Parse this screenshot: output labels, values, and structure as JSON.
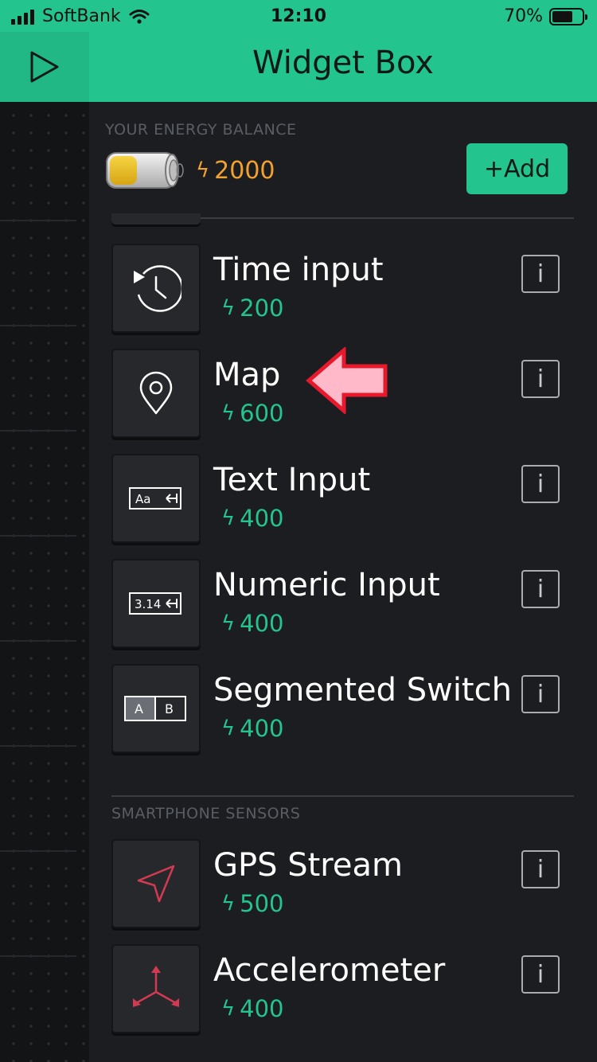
{
  "status_bar": {
    "carrier": "SoftBank",
    "time": "12:10",
    "battery_pct": "70%"
  },
  "header": {
    "title": "Widget Box",
    "play_icon": "play-icon"
  },
  "energy": {
    "label": "YOUR ENERGY BALANCE",
    "amount": "2000",
    "add_label": "+Add"
  },
  "widgets": [
    {
      "name": "Time input",
      "cost": "200",
      "icon": "clock-play-icon"
    },
    {
      "name": "Map",
      "cost": "600",
      "icon": "location-pin-icon"
    },
    {
      "name": "Text Input",
      "cost": "400",
      "icon": "text-input-icon",
      "icon_text": "Aa"
    },
    {
      "name": "Numeric Input",
      "cost": "400",
      "icon": "numeric-input-icon",
      "icon_text": "3.14"
    },
    {
      "name": "Segmented Switch",
      "cost": "400",
      "icon": "segmented-switch-icon",
      "seg_a": "A",
      "seg_b": "B"
    }
  ],
  "sensors_section": {
    "title": "SMARTPHONE SENSORS",
    "items": [
      {
        "name": "GPS Stream",
        "cost": "500",
        "icon": "navigation-arrow-icon"
      },
      {
        "name": "Accelerometer",
        "cost": "400",
        "icon": "axes-icon"
      }
    ]
  },
  "info_label": "i",
  "colors": {
    "accent": "#23c48e",
    "energy": "#f2a12f",
    "background": "#1c1d21",
    "annotation": "#e8192c",
    "sensor_icon": "#d23a52"
  }
}
